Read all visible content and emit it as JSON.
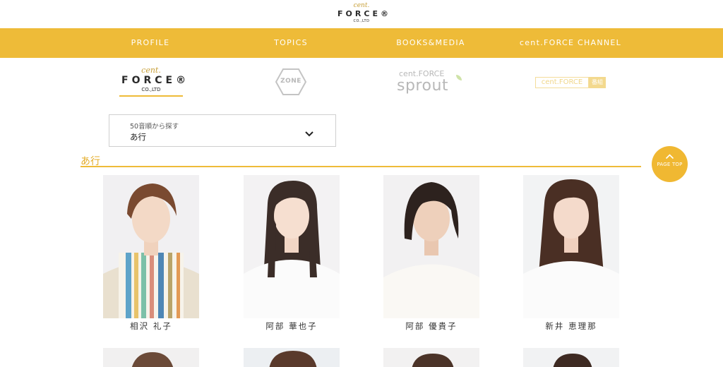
{
  "site": {
    "logo_cent": "cent.",
    "logo_force": "FORCE®",
    "logo_co": "CO.,LTD"
  },
  "nav": {
    "items": [
      {
        "label": "PROFILE"
      },
      {
        "label": "TOPICS"
      },
      {
        "label": "BOOKS&MEDIA"
      },
      {
        "label": "cent.FORCE CHANNEL"
      }
    ]
  },
  "brands": {
    "centforce": {
      "cent": "cent.",
      "force": "FORCE®",
      "co": "CO.,LTD"
    },
    "zone": {
      "label": "ZONE"
    },
    "sprout": {
      "top": "cent.FORCE",
      "main": "sprout"
    },
    "channel": {
      "text": "cent.FORCE",
      "badge": "番組"
    }
  },
  "search": {
    "label": "50音順から探す",
    "value": "あ行"
  },
  "section": {
    "title": "あ行"
  },
  "page_top": {
    "label": "PAGE TOP"
  },
  "talents": [
    {
      "name": "相沢 礼子"
    },
    {
      "name": "阿部 華也子"
    },
    {
      "name": "阿部 優貴子"
    },
    {
      "name": "新井 恵理那"
    }
  ],
  "colors": {
    "accent": "#eebb38",
    "page_top": "#f0b832",
    "section_title": "#e4ad2a"
  }
}
